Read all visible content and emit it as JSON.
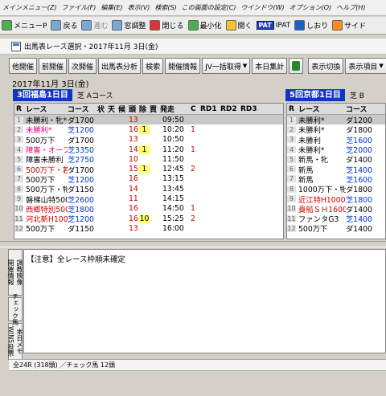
{
  "menubar": [
    "メインメニュー(Z)",
    "ファイル(F)",
    "編集(E)",
    "表示(V)",
    "検索(S)",
    "この画面の設定(C)",
    "ウインドウ(W)",
    "オプション(O)",
    "ヘルプ(H)"
  ],
  "toolbar": {
    "menu": "メニューP",
    "back": "戻る",
    "forward": "進む",
    "window_adjust": "窓調整",
    "close": "閉じる",
    "minimize": "最小化",
    "open": "開く",
    "pat_badge": "PAT",
    "ipat": "IPAT",
    "bookmark": "しおり",
    "side": "サイド"
  },
  "window": {
    "title": "出馬表レース選択・2017年11月 3日(金)"
  },
  "buttons": {
    "prev_meet": "他開催",
    "prev_day": "前開催",
    "next_day": "次開催",
    "analysis": "出馬表分析",
    "search": "検索",
    "meet_info": "開催情報",
    "jv_fetch": "JV一括取得",
    "today_total": "本日集計",
    "display_switch": "表示切換",
    "display_items": "表示項目"
  },
  "date": "2017年11月 3日(金)",
  "venues": [
    {
      "label": "3回福島1日目",
      "course": "芝 Aコース"
    },
    {
      "label": "5回京都1日目",
      "course": "芝 B"
    }
  ],
  "table_headers": {
    "r": "R",
    "race": "レース",
    "course": "コース",
    "status1": "状",
    "weather": "天",
    "cond": "候",
    "heads": "頭",
    "excl": "除",
    "buy": "買",
    "start": "発走",
    "c": "C",
    "rd1": "RD1",
    "rd2": "RD2",
    "rd3": "RD3"
  },
  "fukushima_races": [
    {
      "r": "1",
      "name": "未勝利・牝*",
      "name_color": "black",
      "course": "ダ1700",
      "course_color": "black",
      "heads": "13",
      "excl": "",
      "start": "09:50",
      "c": ""
    },
    {
      "r": "2",
      "name": "未勝利*",
      "name_color": "pink",
      "course": "芝1200",
      "course_color": "blue",
      "heads": "16",
      "excl": "1",
      "start": "10:20",
      "c": "1"
    },
    {
      "r": "3",
      "name": "500万下",
      "name_color": "black",
      "course": "ダ1700",
      "course_color": "black",
      "heads": "13",
      "excl": "",
      "start": "10:50",
      "c": ""
    },
    {
      "r": "4",
      "name": "障害・オープ",
      "name_color": "pink",
      "course": "芝3350",
      "course_color": "blue",
      "heads": "14",
      "excl": "1",
      "start": "11:20",
      "c": "1"
    },
    {
      "r": "5",
      "name": "障害未勝利",
      "name_color": "black",
      "course": "芝2750",
      "course_color": "blue",
      "heads": "10",
      "excl": "",
      "start": "11:50",
      "c": ""
    },
    {
      "r": "6",
      "name": "500万下・若",
      "name_color": "dred",
      "course": "ダ1700",
      "course_color": "black",
      "heads": "15",
      "excl": "1",
      "start": "12:45",
      "c": "2"
    },
    {
      "r": "7",
      "name": "500万下",
      "name_color": "black",
      "course": "芝1200",
      "course_color": "blue",
      "heads": "16",
      "excl": "",
      "start": "13:15",
      "c": ""
    },
    {
      "r": "8",
      "name": "500万下・牝",
      "name_color": "black",
      "course": "ダ1150",
      "course_color": "black",
      "heads": "14",
      "excl": "",
      "start": "13:45",
      "c": ""
    },
    {
      "r": "9",
      "name": "磐梯山特500",
      "name_color": "black",
      "course": "芝2600",
      "course_color": "blue",
      "heads": "11",
      "excl": "",
      "start": "14:15",
      "c": ""
    },
    {
      "r": "10",
      "name": "西郷特別500",
      "name_color": "red",
      "course": "芝1800",
      "course_color": "blue",
      "heads": "16",
      "excl": "",
      "start": "14:50",
      "c": "1"
    },
    {
      "r": "11",
      "name": "河北新H1000",
      "name_color": "red",
      "course": "芝1200",
      "course_color": "blue",
      "heads": "16",
      "excl": "10",
      "start": "15:25",
      "c": "2"
    },
    {
      "r": "12",
      "name": "500万下",
      "name_color": "black",
      "course": "ダ1150",
      "course_color": "black",
      "heads": "13",
      "excl": "",
      "start": "16:00",
      "c": ""
    }
  ],
  "kyoto_races": [
    {
      "r": "1",
      "name": "未勝利*",
      "name_color": "black",
      "course": "ダ1200",
      "course_color": "black"
    },
    {
      "r": "2",
      "name": "未勝利*",
      "name_color": "black",
      "course": "ダ1800",
      "course_color": "black"
    },
    {
      "r": "3",
      "name": "未勝利",
      "name_color": "black",
      "course": "芝1600",
      "course_color": "blue"
    },
    {
      "r": "4",
      "name": "未勝利*",
      "name_color": "black",
      "course": "芝2000",
      "course_color": "blue"
    },
    {
      "r": "5",
      "name": "新馬・牝",
      "name_color": "black",
      "course": "ダ1400",
      "course_color": "black"
    },
    {
      "r": "6",
      "name": "新馬",
      "name_color": "black",
      "course": "芝1400",
      "course_color": "blue"
    },
    {
      "r": "7",
      "name": "新馬",
      "name_color": "black",
      "course": "芝1600",
      "course_color": "blue"
    },
    {
      "r": "8",
      "name": "1000万下・牝",
      "name_color": "black",
      "course": "ダ1800",
      "course_color": "black"
    },
    {
      "r": "9",
      "name": "近江特H1000",
      "name_color": "red",
      "course": "芝1800",
      "course_color": "blue"
    },
    {
      "r": "10",
      "name": "貴船ＳＨ1600",
      "name_color": "red",
      "course": "ダ1400",
      "course_color": "black"
    },
    {
      "r": "11",
      "name": "ファンタG3",
      "name_color": "black",
      "course": "芝1400",
      "course_color": "blue"
    },
    {
      "r": "12",
      "name": "500万下",
      "name_color": "black",
      "course": "ダ1400",
      "course_color": "black"
    }
  ],
  "notice": "【注意】全レース枠順未確定",
  "side_tabs": [
    "開催情報",
    "調教映像",
    "チェック馬",
    "WIN5投票",
    "本日メモ"
  ],
  "status": "全24R (318頭) ／チェック馬 12頭"
}
